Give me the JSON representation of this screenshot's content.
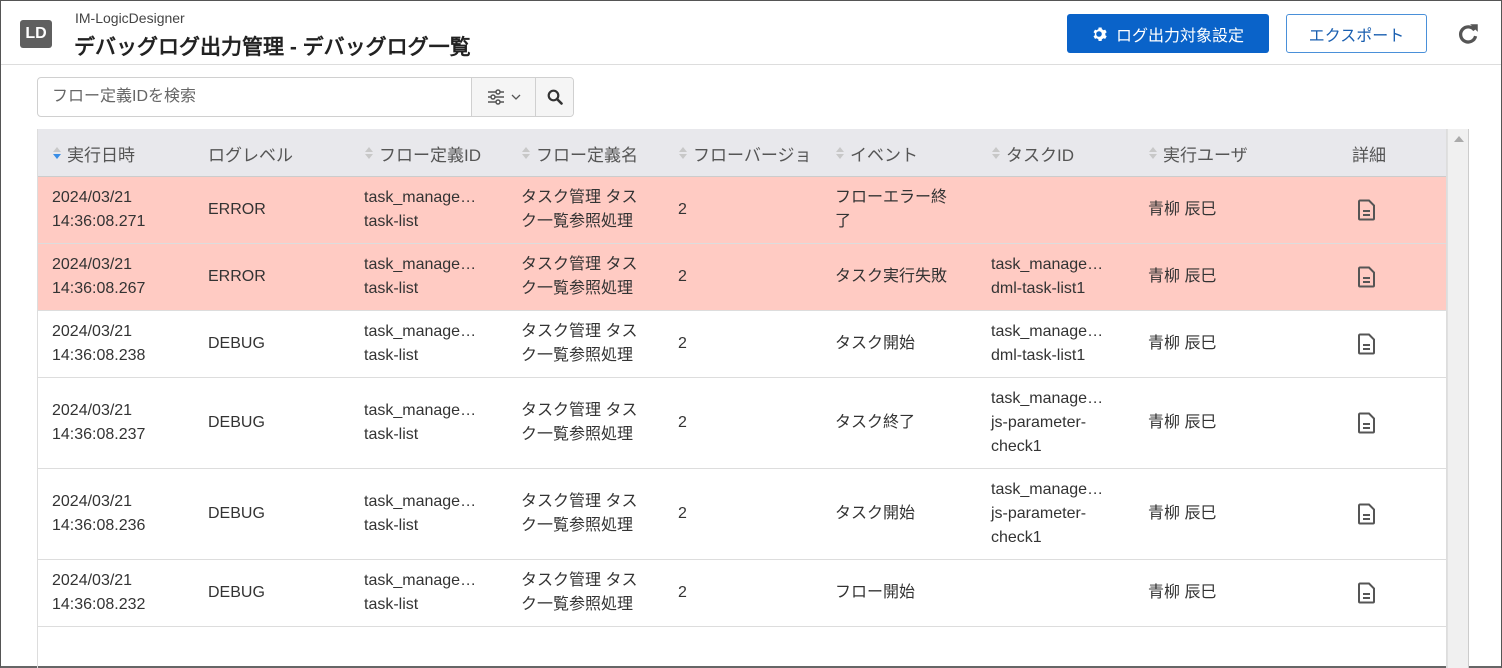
{
  "header": {
    "logo": "LD",
    "app_name": "IM-LogicDesigner",
    "title": "デバッグログ出力管理 - デバッグログ一覧",
    "settings_button": "ログ出力対象設定",
    "export_button": "エクスポート",
    "refresh_icon": "refresh-icon"
  },
  "search": {
    "placeholder": "フロー定義IDを検索",
    "value": "",
    "filter_icon": "sliders-icon",
    "search_icon": "search-icon"
  },
  "colors": {
    "primary": "#0a63c9",
    "error_row": "#ffcbc3",
    "header_bg": "#e8e8ec"
  },
  "table": {
    "columns": [
      {
        "label": "実行日時",
        "sortable": true,
        "sorted": "desc"
      },
      {
        "label": "ログレベル",
        "sortable": false
      },
      {
        "label": "フロー定義ID",
        "sortable": true
      },
      {
        "label": "フロー定義名",
        "sortable": true
      },
      {
        "label": "フローバージョ",
        "sortable": true
      },
      {
        "label": "イベント",
        "sortable": true
      },
      {
        "label": "タスクID",
        "sortable": true
      },
      {
        "label": "実行ユーザ",
        "sortable": true
      },
      {
        "label": "詳細",
        "sortable": false
      }
    ],
    "rows": [
      {
        "date": "2024/03/21",
        "time": "14:36:08.271",
        "level": "ERROR",
        "flow_id_1": "task_manage…",
        "flow_id_2": "task-list",
        "flow_name_1": "タスク管理 タス",
        "flow_name_2": "ク一覧参照処理",
        "version": "2",
        "event_1": "フローエラー終",
        "event_2": "了",
        "task_id": [],
        "user": "青柳 辰巳"
      },
      {
        "date": "2024/03/21",
        "time": "14:36:08.267",
        "level": "ERROR",
        "flow_id_1": "task_manage…",
        "flow_id_2": "task-list",
        "flow_name_1": "タスク管理 タス",
        "flow_name_2": "ク一覧参照処理",
        "version": "2",
        "event_1": "タスク実行失敗",
        "event_2": "",
        "task_id": [
          "task_manage…",
          "dml-task-list1"
        ],
        "user": "青柳 辰巳"
      },
      {
        "date": "2024/03/21",
        "time": "14:36:08.238",
        "level": "DEBUG",
        "flow_id_1": "task_manage…",
        "flow_id_2": "task-list",
        "flow_name_1": "タスク管理 タス",
        "flow_name_2": "ク一覧参照処理",
        "version": "2",
        "event_1": "タスク開始",
        "event_2": "",
        "task_id": [
          "task_manage…",
          "dml-task-list1"
        ],
        "user": "青柳 辰巳"
      },
      {
        "date": "2024/03/21",
        "time": "14:36:08.237",
        "level": "DEBUG",
        "flow_id_1": "task_manage…",
        "flow_id_2": "task-list",
        "flow_name_1": "タスク管理 タス",
        "flow_name_2": "ク一覧参照処理",
        "version": "2",
        "event_1": "タスク終了",
        "event_2": "",
        "task_id": [
          "task_manage…",
          "js-parameter-",
          "check1"
        ],
        "user": "青柳 辰巳"
      },
      {
        "date": "2024/03/21",
        "time": "14:36:08.236",
        "level": "DEBUG",
        "flow_id_1": "task_manage…",
        "flow_id_2": "task-list",
        "flow_name_1": "タスク管理 タス",
        "flow_name_2": "ク一覧参照処理",
        "version": "2",
        "event_1": "タスク開始",
        "event_2": "",
        "task_id": [
          "task_manage…",
          "js-parameter-",
          "check1"
        ],
        "user": "青柳 辰巳"
      },
      {
        "date": "2024/03/21",
        "time": "14:36:08.232",
        "level": "DEBUG",
        "flow_id_1": "task_manage…",
        "flow_id_2": "task-list",
        "flow_name_1": "タスク管理 タス",
        "flow_name_2": "ク一覧参照処理",
        "version": "2",
        "event_1": "フロー開始",
        "event_2": "",
        "task_id": [],
        "user": "青柳 辰巳"
      }
    ]
  }
}
